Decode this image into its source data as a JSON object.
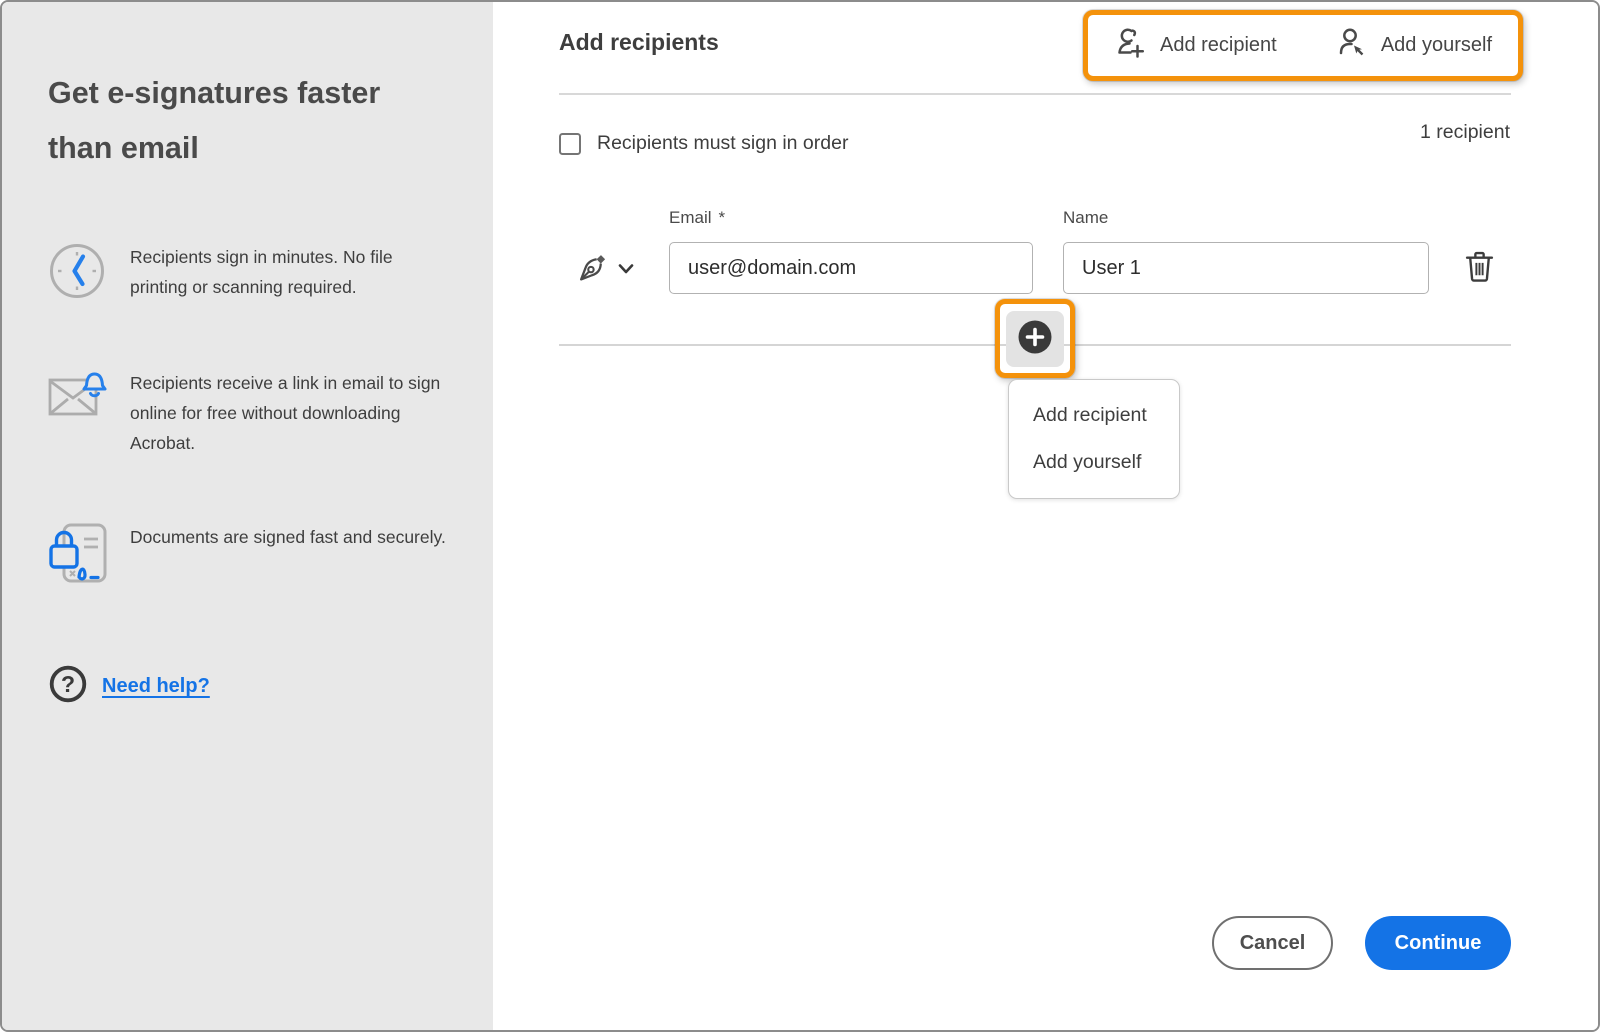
{
  "colors": {
    "highlight_orange": "#F4920B",
    "primary_blue": "#1473E6",
    "link_blue": "#1473E6",
    "icon_accent_blue": "#2680EB",
    "sidebar_background": "#E8E8E8"
  },
  "sidebar": {
    "heading": "Get e-signatures faster than email",
    "benefits": [
      {
        "icon": "clock-icon",
        "text": "Recipients sign in minutes. No file printing or scanning required."
      },
      {
        "icon": "email-notification-icon",
        "text": "Recipients receive a link in email to sign online for free without downloading Acrobat."
      },
      {
        "icon": "secure-document-icon",
        "text": "Documents are signed fast and securely."
      }
    ],
    "help_link_label": "Need help?"
  },
  "header": {
    "title": "Add recipients",
    "actions": [
      {
        "icon": "add-user-icon",
        "label": "Add recipient"
      },
      {
        "icon": "add-self-icon",
        "label": "Add yourself"
      }
    ]
  },
  "recipients_panel": {
    "sign_in_order_label": "Recipients must sign in order",
    "order_checkbox_checked": false,
    "count_label": "1 recipient",
    "email_field_label": "Email",
    "required_mark": "*",
    "name_field_label": "Name",
    "rows": [
      {
        "email": "user@domain.com",
        "name": "User 1"
      }
    ]
  },
  "add_menu": {
    "items": [
      "Add recipient",
      "Add yourself"
    ]
  },
  "footer": {
    "cancel_label": "Cancel",
    "continue_label": "Continue"
  }
}
